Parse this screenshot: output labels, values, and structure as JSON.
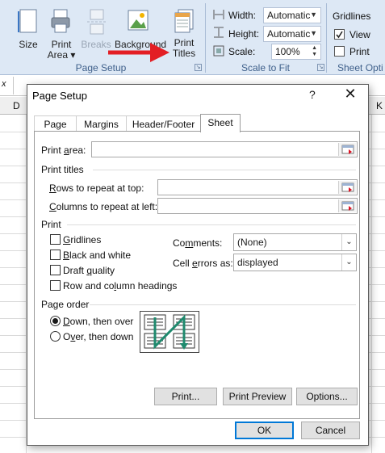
{
  "ribbon": {
    "buttons": {
      "size": "Size",
      "print_area": [
        "Print",
        "Area ▾"
      ],
      "breaks": "Breaks",
      "background": "Background",
      "print_titles": [
        "Print",
        "Titles"
      ]
    },
    "page_setup_group": "Page Setup",
    "scale_to_fit_group": "Scale to Fit",
    "sheet_options_group": "Sheet Opti",
    "width_label": "Width:",
    "width_value": "Automatic",
    "height_label": "Height:",
    "height_value": "Automatic",
    "scale_label": "Scale:",
    "scale_value": "100%",
    "gridlines_header": "Gridlines",
    "view_label": "View",
    "print_label": "Print"
  },
  "sheet": {
    "col_left": "D",
    "col_right": "K",
    "fx": "x"
  },
  "dialog": {
    "title": "Page Setup",
    "help": "?",
    "close": "✕",
    "tabs": [
      "Page",
      "Margins",
      "Header/Footer",
      "Sheet"
    ],
    "active_tab": "Sheet",
    "print_area": {
      "pre": "Print ",
      "key": "a",
      "post": "rea:"
    },
    "print_titles": "Print titles",
    "rows_repeat": {
      "pre": "",
      "key": "R",
      "post": "ows to repeat at top:"
    },
    "cols_repeat": {
      "pre": "",
      "key": "C",
      "post": "olumns to repeat at left:"
    },
    "print_section": "Print",
    "checks": {
      "gridlines": {
        "key": "G",
        "post": "ridlines",
        "checked": false
      },
      "black_white": {
        "key": "B",
        "post": "lack and white",
        "checked": false
      },
      "draft": {
        "pre": "Draft ",
        "key": "q",
        "post": "uality",
        "checked": false
      },
      "headings": {
        "pre": "Row and co",
        "key": "l",
        "post": "umn headings",
        "checked": false
      }
    },
    "comments": {
      "pre": "Co",
      "key": "m",
      "post": "ments:",
      "value": "(None)"
    },
    "cell_errors": {
      "pre": "Cell ",
      "key": "e",
      "post": "rrors as:",
      "value": "displayed"
    },
    "page_order": "Page order",
    "down_then_over": {
      "key": "D",
      "post": "own, then over",
      "selected": true
    },
    "over_then_down": {
      "pre": "O",
      "key": "v",
      "post": "er, then down",
      "selected": false
    },
    "buttons": {
      "print": "Print...",
      "print_preview": "Print Preview",
      "options": "Options...",
      "ok": "OK",
      "cancel": "Cancel"
    }
  },
  "colors": {
    "ribbon_bg": "#dde8f5",
    "arrow": "#e31e24",
    "accent": "#0078d7"
  }
}
